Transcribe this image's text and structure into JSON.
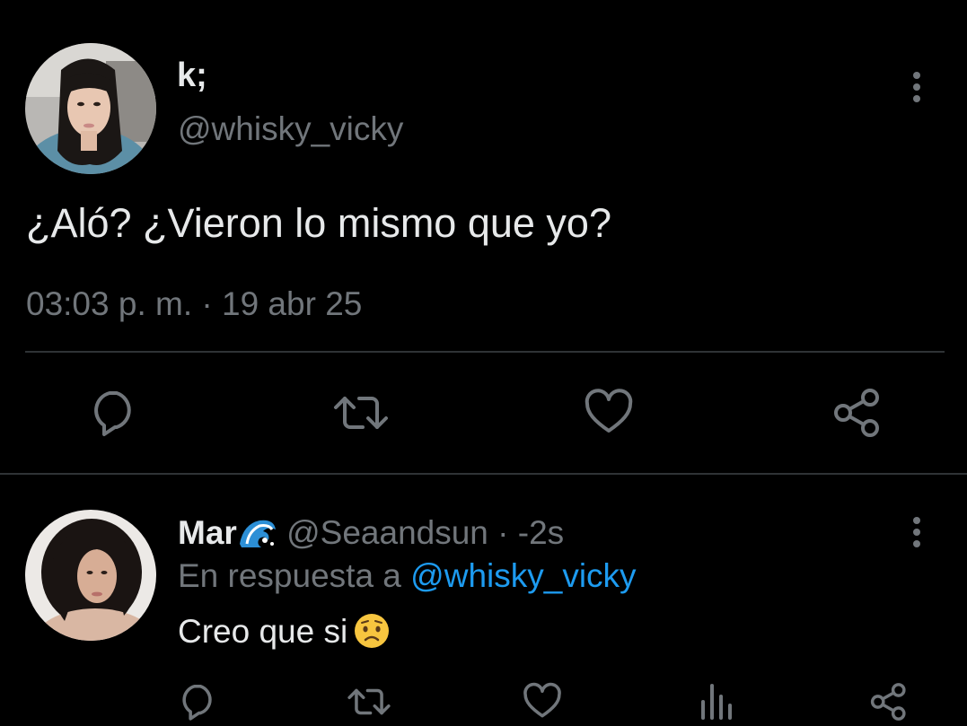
{
  "colors": {
    "background": "#000000",
    "primary_text": "#e7e9ea",
    "secondary_text": "#71767b",
    "divider": "#2f3336",
    "link": "#1d9bf0"
  },
  "main_tweet": {
    "display_name": "k;",
    "handle": "@whisky_vicky",
    "text": "¿Aló? ¿Vieron lo mismo que yo?",
    "time": "03:03 p. m.",
    "separator": "·",
    "date": "19 abr 25",
    "icons": {
      "more": "more-vertical-icon",
      "reply": "reply-icon",
      "retweet": "retweet-icon",
      "like": "heart-icon",
      "share": "share-icon"
    }
  },
  "reply_tweet": {
    "display_name": "Mar",
    "name_emoji": "water-wave-emoji",
    "handle": "@Seaandsun",
    "separator": "·",
    "time_ago": "-2s",
    "context_prefix": "En respuesta a",
    "context_mention": "@whisky_vicky",
    "text": "Creo que si",
    "text_emoji": "worried-face-emoji",
    "icons": {
      "more": "more-vertical-icon",
      "reply": "reply-icon",
      "retweet": "retweet-icon",
      "like": "heart-icon",
      "views": "views-icon",
      "share": "share-icon"
    }
  }
}
